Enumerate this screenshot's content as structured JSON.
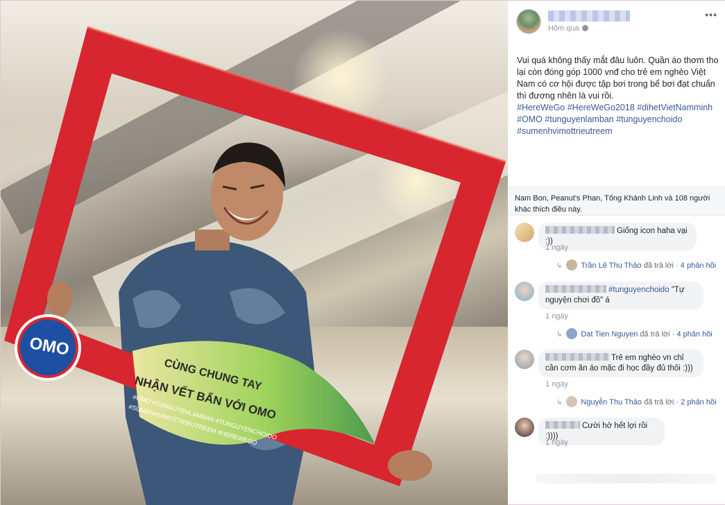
{
  "post": {
    "time": "Hôm qua",
    "more_label": "•••",
    "text": "Vui quá không thấy mắt đâu luôn. Quần áo thơm tho lại còn đóng góp 1000 vnđ cho trẻ em nghèo Việt Nam có cơ hội được tập bơi trong bể bơi đạt chuẩn thì đương nhên là vui rồi.",
    "hashtags": [
      "#HereWeGo",
      "#HereWeGo2018",
      "#dihetVietNamminh",
      "#OMO",
      "#tunguyenlamban",
      "#tunguyenchoido",
      "#sumenhvimottrieutreem"
    ]
  },
  "photo": {
    "brand": "OMO",
    "banner_line1": "CÙNG CHUNG TAY",
    "banner_line2": "NHẬN VẾT BẨN VỚI OMO",
    "banner_tags1": "#OMO #TUNGUYENLAMBAN #TUNGUYENCHOIDO",
    "banner_tags2": "#SUMENHVIMOTTRIEUTREEM #HEREWEGO"
  },
  "likes": {
    "text": "Nam Bon, Peanut's Phan, Tống Khánh Linh và 108 người khác thích điều này."
  },
  "comments": [
    {
      "text": "Giống icon haha vại :))",
      "time": "1 ngày",
      "reply": {
        "name": "Trần Lê Thu Thảo",
        "action": "đã trả lời",
        "sep": "·",
        "count": "4 phản hồi"
      }
    },
    {
      "tag": "#tunguyenchoido",
      "text": "\"Tự nguyện chơi đồ\" á",
      "time": "1 ngày",
      "reply": {
        "name": "Dat Tien Nguyen",
        "action": "đã trả lời",
        "sep": "·",
        "count": "4 phản hồi"
      }
    },
    {
      "text": "Trẻ em nghèo vn chỉ cần cơm ăn áo mặc đi học đầy đủ thôi :)))",
      "time": "1 ngày",
      "reply": {
        "name": "Nguyễn Thu Thảo",
        "action": "đã trả lời",
        "sep": "·",
        "count": "2 phản hồi"
      }
    },
    {
      "text": "Cười hở hết lợi rồi :))))",
      "time": "1 ngày"
    }
  ],
  "colors": {
    "link": "#365899",
    "frame_red": "#d7262f",
    "meta": "#90949c"
  }
}
